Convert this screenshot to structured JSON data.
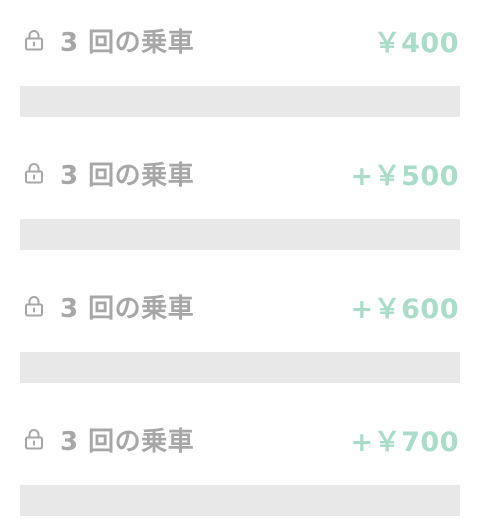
{
  "tiers": [
    {
      "label": "3 回の乗車",
      "reward": "￥400",
      "icon": "lock-icon",
      "progress": 0
    },
    {
      "label": "3 回の乗車",
      "reward": "+￥500",
      "icon": "lock-icon",
      "progress": 0
    },
    {
      "label": "3 回の乗車",
      "reward": "+￥600",
      "icon": "lock-icon",
      "progress": 0
    },
    {
      "label": "3 回の乗車",
      "reward": "+￥700",
      "icon": "lock-icon",
      "progress": 0
    }
  ],
  "colors": {
    "label": "#a7a7a7",
    "reward": "#a9dcc9",
    "track": "#e8e8e8"
  }
}
